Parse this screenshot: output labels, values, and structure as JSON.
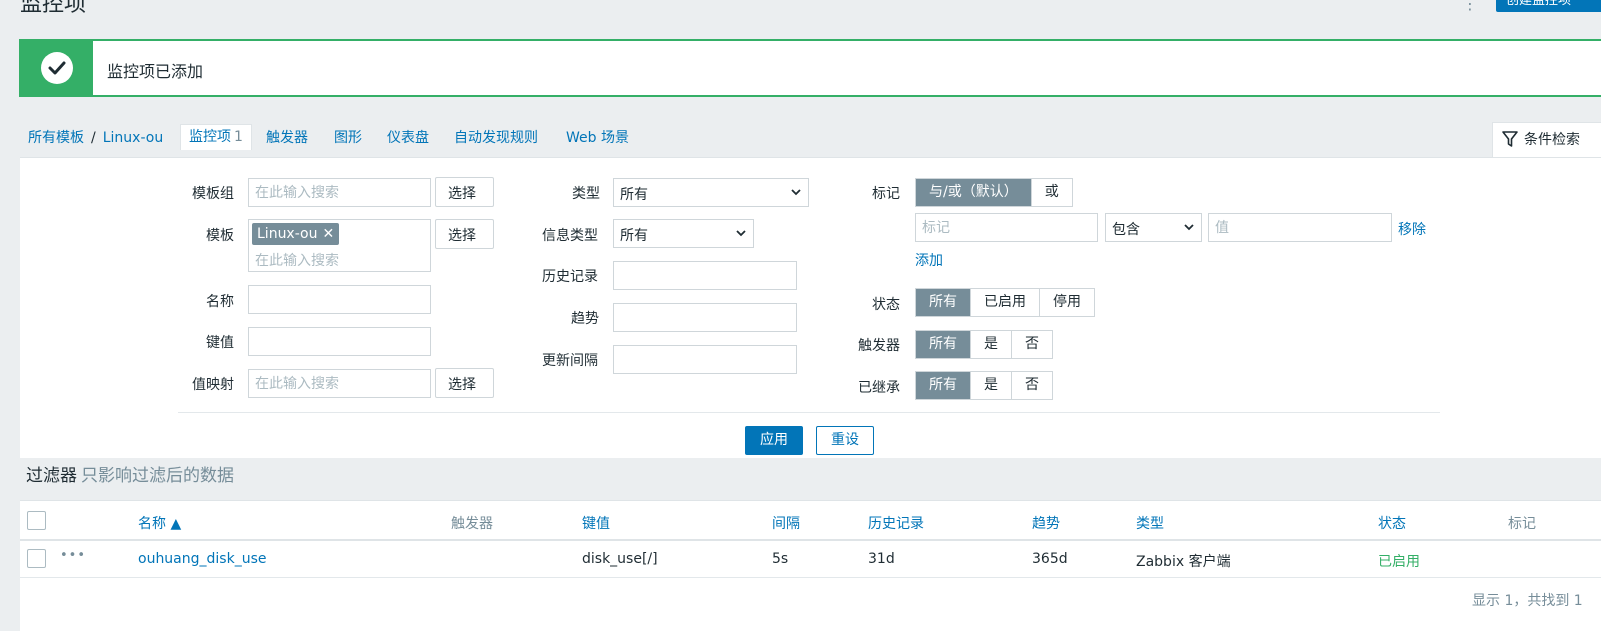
{
  "page": {
    "title": "监控项",
    "create_button": "创建监控项"
  },
  "message": {
    "text": "监控项已添加"
  },
  "nav": {
    "all_templates": "所有模板",
    "separator": "/",
    "template": "Linux-ou",
    "items_tab": "监控项",
    "items_count": "1",
    "triggers": "触发器",
    "graphs": "图形",
    "dashboards": "仪表盘",
    "discovery": "自动发现规则",
    "web": "Web 场景"
  },
  "filter_tab": {
    "label": "条件检索"
  },
  "filter": {
    "template_group": {
      "label": "模板组",
      "placeholder": "在此输入搜索",
      "button": "选择"
    },
    "template": {
      "label": "模板",
      "chip": "Linux-ou",
      "chip_close": "✕",
      "placeholder": "在此输入搜索",
      "button": "选择"
    },
    "name": {
      "label": "名称",
      "value": ""
    },
    "key": {
      "label": "键值",
      "value": ""
    },
    "value_map": {
      "label": "值映射",
      "placeholder": "在此输入搜索",
      "button": "选择"
    },
    "type": {
      "label": "类型",
      "value": "所有"
    },
    "info_type": {
      "label": "信息类型",
      "value": "所有"
    },
    "history": {
      "label": "历史记录",
      "value": ""
    },
    "trends": {
      "label": "趋势",
      "value": ""
    },
    "interval": {
      "label": "更新间隔",
      "value": ""
    },
    "tags": {
      "label": "标记",
      "andor": "与/或（默认）",
      "or": "或",
      "tag_placeholder": "标记",
      "operator": "包含",
      "value_placeholder": "值",
      "remove": "移除",
      "add": "添加"
    },
    "state": {
      "label": "状态",
      "options": [
        "所有",
        "已启用",
        "停用"
      ]
    },
    "triggers": {
      "label": "触发器",
      "options": [
        "所有",
        "是",
        "否"
      ]
    },
    "inherited": {
      "label": "已继承",
      "options": [
        "所有",
        "是",
        "否"
      ]
    },
    "apply": "应用",
    "reset": "重设"
  },
  "subfilter": {
    "title": "过滤器",
    "hint": "只影响过滤后的数据"
  },
  "table": {
    "headers": {
      "name": "名称 ▲",
      "triggers": "触发器",
      "key": "键值",
      "interval": "间隔",
      "history": "历史记录",
      "trends": "趋势",
      "type": "类型",
      "status": "状态",
      "tags": "标记"
    },
    "rows": [
      {
        "more": "•••",
        "name": "ouhuang_disk_use",
        "key": "disk_use[/]",
        "interval": "5s",
        "history": "31d",
        "trends": "365d",
        "type": "Zabbix 客户端",
        "status": "已启用"
      }
    ],
    "footer": "显示 1，共找到 1"
  },
  "colors": {
    "accent": "#0275b8",
    "success": "#34af67",
    "muted": "#768d99"
  }
}
